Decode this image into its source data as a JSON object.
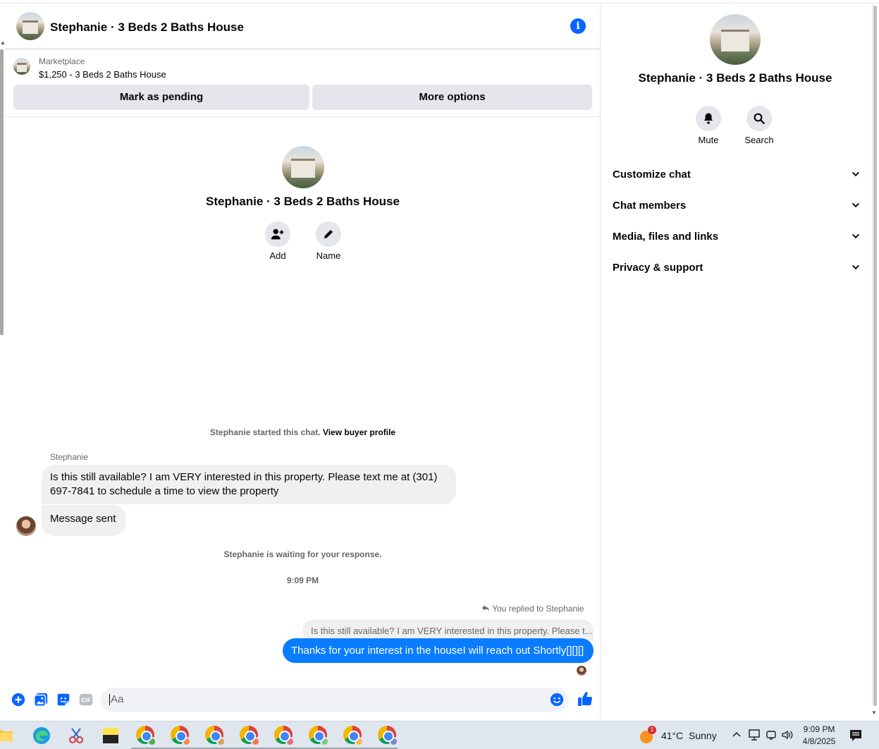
{
  "header": {
    "title": "Stephanie · 3 Beds 2 Baths House"
  },
  "marketplace": {
    "label": "Marketplace",
    "listing": "$1,250 - 3 Beds 2 Baths House",
    "mark_pending_label": "Mark as pending",
    "more_options_label": "More options"
  },
  "intro": {
    "name": "Stephanie · 3 Beds 2 Baths House",
    "add_label": "Add",
    "name_label": "Name"
  },
  "chat": {
    "started_text": "Stephanie started this chat.",
    "view_buyer_link": "View buyer profile",
    "sender_name": "Stephanie",
    "message_1_line1": "Is this still available? I am VERY interested in this property. Please text me at (301)",
    "message_1_line2": "697-7841 to schedule a time to view the property",
    "message_2": "Message sent",
    "waiting_text": "Stephanie is waiting for your response.",
    "timestamp": "9:09 PM",
    "reply_note": "You replied to Stephanie",
    "quoted_text": "Is this still available? I am VERY interested in this property. Please t...",
    "outgoing_message": "Thanks for your interest in the houseI will reach out Shortly[][][]"
  },
  "composer": {
    "placeholder": "Aa"
  },
  "right_panel": {
    "name": "Stephanie · 3 Beds 2 Baths House",
    "mute_label": "Mute",
    "search_label": "Search",
    "sections": [
      {
        "label": "Customize chat"
      },
      {
        "label": "Chat members"
      },
      {
        "label": "Media, files and links"
      },
      {
        "label": "Privacy & support"
      }
    ]
  },
  "taskbar": {
    "weather_temp": "41°C",
    "weather_desc": "Sunny",
    "weather_badge": "1",
    "time": "9:09 PM",
    "date": "4/8/2025"
  },
  "colors": {
    "accent": "#0866ff",
    "outgoing_bubble": "#0a7cff",
    "button_bg": "#e4e6eb",
    "incoming_bubble": "#f0f0f0"
  }
}
